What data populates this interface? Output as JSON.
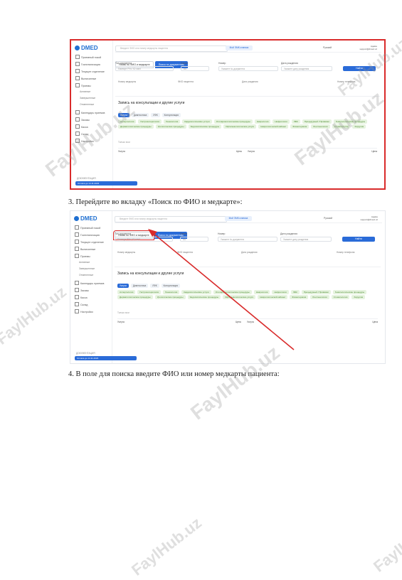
{
  "steps": {
    "step3": "3.   Перейдите во вкладку «Поиск по ФИО и медкарте»:",
    "step4": "4.   В поле для поиска введите ФИО или номер медкарты пациента:"
  },
  "watermark": "FaylHub.uz",
  "app": {
    "logo": "DMED",
    "sidebar": [
      {
        "label": "Приемный покой"
      },
      {
        "label": "Госпитализация"
      },
      {
        "label": "Текущее отделение"
      },
      {
        "label": "Выписанные"
      },
      {
        "label": "Приемы"
      },
      {
        "label": "Активные",
        "sub": true
      },
      {
        "label": "Завершенные",
        "sub": true
      },
      {
        "label": "Отмененные",
        "sub": true
      },
      {
        "label": "Календарь приемов"
      },
      {
        "label": "Заказы"
      },
      {
        "label": "Касса"
      },
      {
        "label": "Склад"
      },
      {
        "label": "Настройки"
      }
    ],
    "bottom_label": "ДОКУМЕНТАЦИЯ",
    "bottom_bar": "Оплата до 14.11.2023",
    "search_placeholder": "Введите ФИО или номер медкарты пациента",
    "pill": "Мой ЭМК клиника",
    "lang": "Русский",
    "user_name": "Админ",
    "user_email": "support@dmed.uz",
    "tabs": [
      "Поиск по ФИО и медкарте",
      "Поиск по документам"
    ],
    "form": {
      "doc_type_label": "Тип документа",
      "doc_type_value": "Паспорт РУз / ID card",
      "series_label": "Серия",
      "series_value": "AA",
      "number_label": "Номер",
      "number_placeholder": "Укажите № документа",
      "dob_label": "Дата рождения",
      "dob_placeholder": "Укажите дату рождения",
      "find_button": "Найти"
    },
    "columns": [
      "Номер медкарты",
      "ФИО пациента",
      "Дата рождения",
      "Номер телефона"
    ],
    "panel_title": "Запись на консультации и другие услуги",
    "categories": [
      "Услуги",
      "Диагностика",
      "ЛФК",
      "Консультация"
    ],
    "services": [
      "Аллергология",
      "Гастроэнтерология",
      "Гинекология",
      "Кардиологические услуги",
      "Отоларингологические процедуры",
      "Неврология",
      "Нефрология",
      "ЛФК",
      "Процедурный / Прививки",
      "Гематологические процедуры",
      "Дерматологические процедуры",
      "Урологические процедуры",
      "Эндоскопические процедуры",
      "Офтальмологические услуги",
      "Неврологический кабинет",
      "Физиотерапия",
      "Рентгенология",
      "Стоматология",
      "Хирургия"
    ],
    "checkbox_label": "Только мои",
    "rows": [
      {
        "service": "Услуга",
        "price_label": "Цена",
        "col2": "Услуга",
        "price2": "Цена"
      }
    ]
  }
}
